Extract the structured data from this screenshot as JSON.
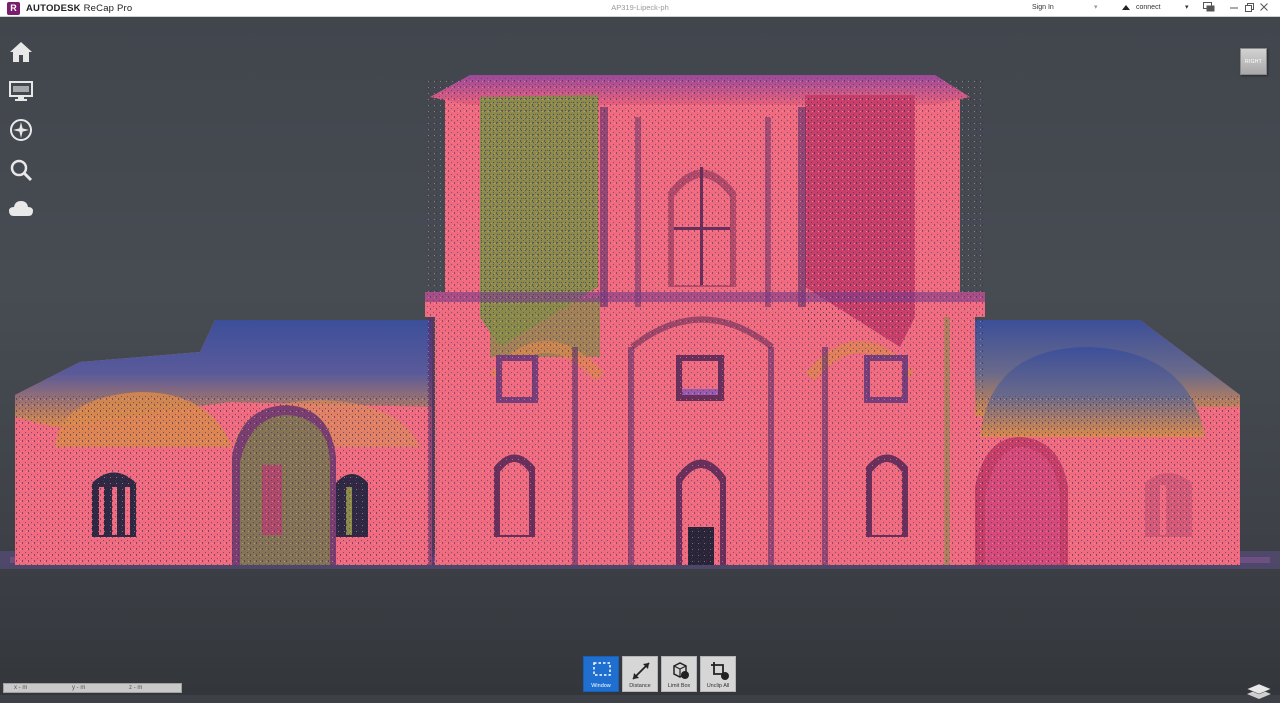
{
  "titlebar": {
    "logo_letter": "R",
    "brand": "AUTODESK",
    "product": "ReCap Pro",
    "document_title": "AP319-Lipeck-ph",
    "sign_in": "Sign In",
    "dropdown_arrow": "▾",
    "connect": "connect",
    "icons": [
      "chat-icon",
      "minimize-icon",
      "restore-icon",
      "close-icon"
    ]
  },
  "left_toolbar": {
    "items": [
      "home-icon",
      "display-settings-icon",
      "navigation-wheel-icon",
      "search-icon",
      "cloud-icon"
    ]
  },
  "viewcube": {
    "label": "RIGHT"
  },
  "bottom_toolbar": {
    "tools": [
      {
        "label": "Window",
        "icon": "window-select-icon",
        "active": true
      },
      {
        "label": "Distance",
        "icon": "distance-icon",
        "active": false
      },
      {
        "label": "Limit Box",
        "icon": "limit-box-icon",
        "active": false
      },
      {
        "label": "Unclip All",
        "icon": "unclip-all-icon",
        "active": false
      }
    ]
  },
  "coordinates": {
    "x": "x - m",
    "y": "y - m",
    "z": "z - m"
  },
  "colors": {
    "brand": "#7a1d6e",
    "active_tool": "#1e6fd0",
    "background": "#3d4147",
    "pointcloud_pink": "#f2677a",
    "pointcloud_purple": "#8a3a8c",
    "pointcloud_blue": "#3c4f9a",
    "pointcloud_olive": "#8a8a4a",
    "pointcloud_orange": "#d9894a"
  }
}
